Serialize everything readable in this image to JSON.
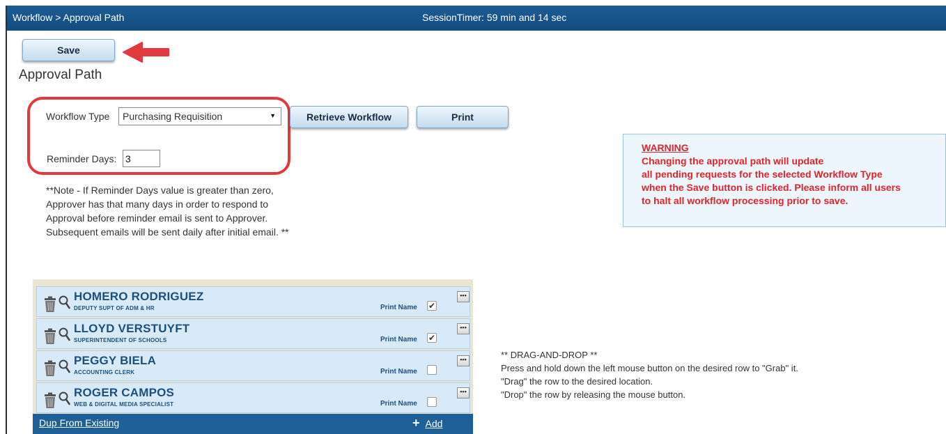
{
  "topbar": {
    "breadcrumb": "Workflow > Approval Path",
    "session_timer": "SessionTimer: 59 min and 14 sec"
  },
  "toolbar": {
    "save_label": "Save"
  },
  "page": {
    "title": "Approval Path"
  },
  "form": {
    "workflow_type_label": "Workflow Type",
    "workflow_type_value": "Purchasing Requisition",
    "retrieve_label": "Retrieve Workflow",
    "print_label": "Print",
    "reminder_days_label": "Reminder Days:",
    "reminder_days_value": "3",
    "note_lines": [
      "**Note - If Reminder Days value is greater than zero,",
      "Approver has that many days in order to respond to",
      "Approval before reminder email is sent to Approver.",
      "Subsequent emails will be sent daily after initial email. **"
    ]
  },
  "warning": {
    "title": "WARNING",
    "lines": [
      "Changing the approval path will update",
      "all pending requests for the selected Workflow Type",
      "when the Save button is clicked. Please inform all users",
      "to halt all workflow processing prior to save."
    ]
  },
  "approvers": [
    {
      "name": "HOMERO RODRIGUEZ",
      "title": "DEPUTY SUPT OF ADM & HR",
      "print_name_label": "Print Name",
      "print_name_checked": true
    },
    {
      "name": "LLOYD VERSTUYFT",
      "title": "SUPERINTENDENT OF SCHOOLS",
      "print_name_label": "Print Name",
      "print_name_checked": true
    },
    {
      "name": "PEGGY BIELA",
      "title": "ACCOUNTING CLERK",
      "print_name_label": "Print Name",
      "print_name_checked": false
    },
    {
      "name": "ROGER CAMPOS",
      "title": "WEB & DIGITAL MEDIA SPECIALIST",
      "print_name_label": "Print Name",
      "print_name_checked": false
    }
  ],
  "list_footer": {
    "dup_label": "Dup From Existing",
    "add_label": "Add"
  },
  "drag_drop_help": [
    "** DRAG-AND-DROP **",
    "Press and hold down the left mouse button on the desired row to \"Grab\" it.",
    "\"Drag\" the row to the desired location.",
    "\"Drop\" the row by releasing the mouse button."
  ],
  "colors": {
    "header_bg": "#1a5588",
    "warning_text": "#e0242b",
    "highlight_border": "#e03a3f",
    "row_bg": "#d8e9f7",
    "name_text": "#1d4f7c"
  }
}
